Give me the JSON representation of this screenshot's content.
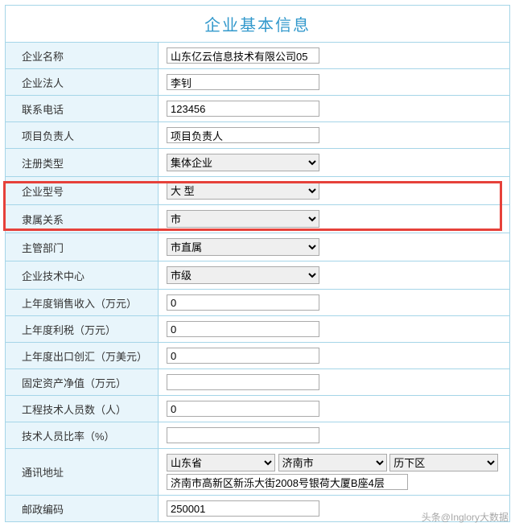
{
  "title": "企业基本信息",
  "labels": {
    "company_name": "企业名称",
    "legal_person": "企业法人",
    "phone": "联系电话",
    "project_leader": "项目负责人",
    "reg_type": "注册类型",
    "enterprise_model": "企业型号",
    "affiliation": "隶属关系",
    "supervisor_dept": "主管部门",
    "tech_center": "企业技术中心",
    "prev_sales": "上年度销售收入（万元）",
    "prev_tax": "上年度利税（万元）",
    "prev_export": "上年度出口创汇（万美元）",
    "fixed_assets": "固定资产净值（万元）",
    "eng_staff": "工程技术人员数（人）",
    "tech_ratio": "技术人员比率（%）",
    "address": "通讯地址",
    "postcode": "邮政编码"
  },
  "values": {
    "company_name": "山东亿云信息技术有限公司05",
    "legal_person": "李钊",
    "phone": "123456",
    "project_leader": "项目负责人",
    "reg_type": "集体企业",
    "enterprise_model": "大 型",
    "affiliation": "市",
    "supervisor_dept": "市直属",
    "tech_center": "市级",
    "prev_sales": "0",
    "prev_tax": "0",
    "prev_export": "0",
    "fixed_assets": "",
    "eng_staff": "0",
    "tech_ratio": "",
    "addr_province": "山东省",
    "addr_city": "济南市",
    "addr_district": "历下区",
    "addr_detail": "济南市高新区新泺大街2008号银荷大厦B座4层",
    "postcode": "250001"
  },
  "watermark": "头条@Inglory大数据"
}
